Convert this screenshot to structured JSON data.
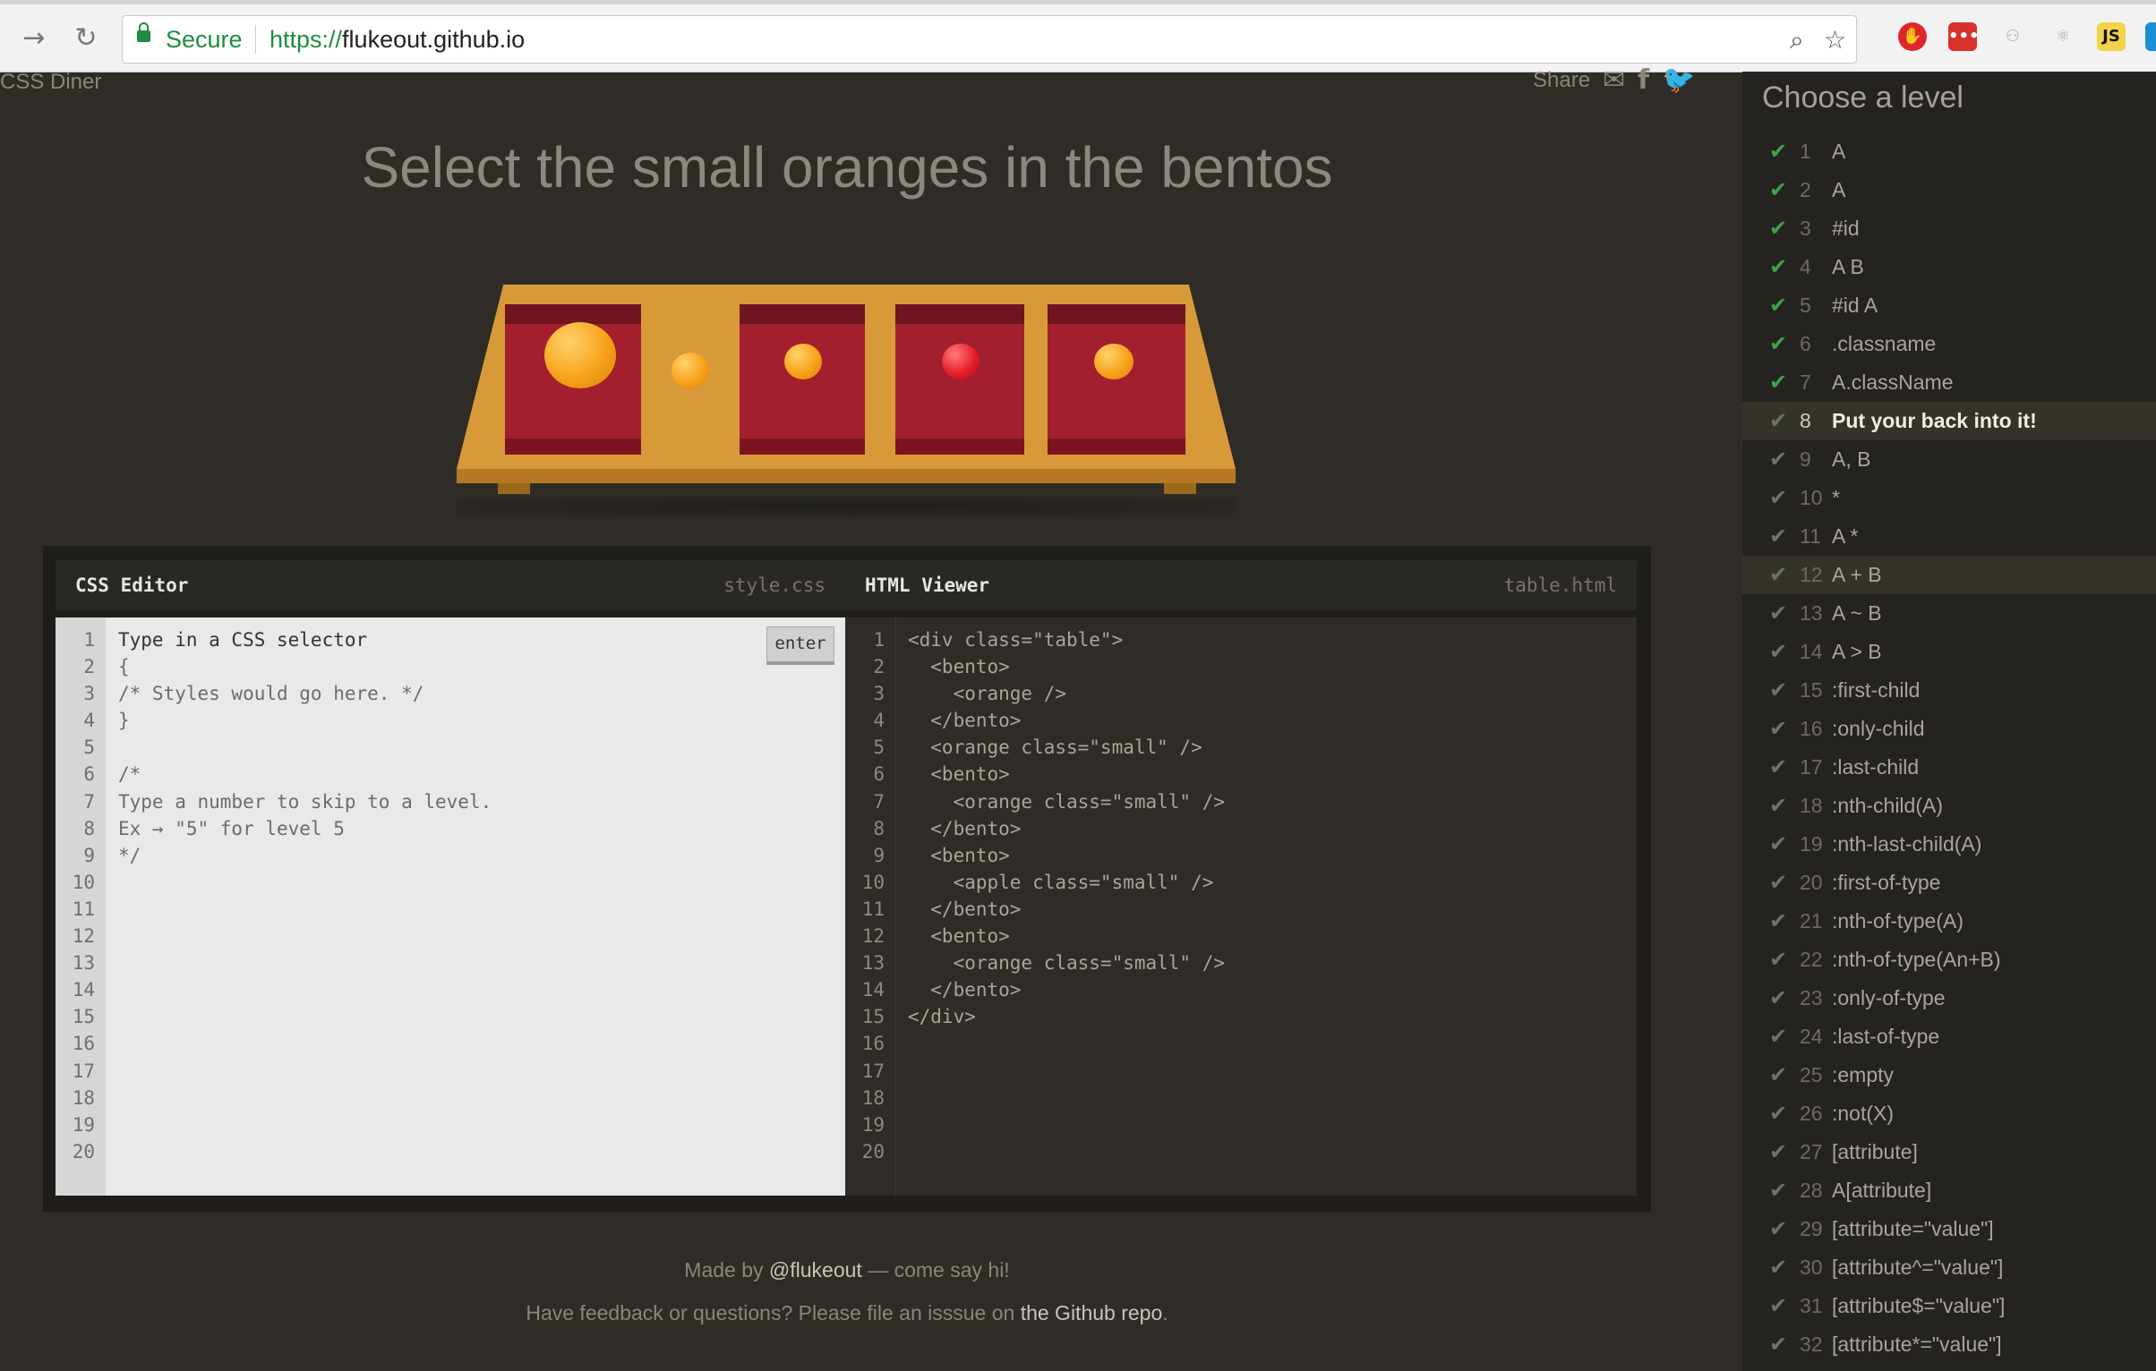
{
  "browser": {
    "secure_label": "Secure",
    "url_scheme": "https://",
    "url_host": "flukeout.github.io"
  },
  "game": {
    "logo": "CSS Diner",
    "share_label": "Share",
    "order": "Select the small oranges in the bentos"
  },
  "css_editor": {
    "title": "CSS Editor",
    "file": "style.css",
    "enter_label": "enter",
    "line_numbers": [
      "1",
      "2",
      "3",
      "4",
      "5",
      "6",
      "7",
      "8",
      "9",
      "10",
      "11",
      "12",
      "13",
      "14",
      "15",
      "16",
      "17",
      "18",
      "19",
      "20"
    ],
    "lines": [
      "Type in a CSS selector",
      "{",
      "/* Styles would go here. */",
      "}",
      "",
      "/*",
      "Type a number to skip to a level.",
      "Ex → \"5\" for level 5",
      "*/"
    ]
  },
  "html_viewer": {
    "title": "HTML Viewer",
    "file": "table.html",
    "line_numbers": [
      "1",
      "2",
      "3",
      "4",
      "5",
      "6",
      "7",
      "8",
      "9",
      "10",
      "11",
      "12",
      "13",
      "14",
      "15",
      "16",
      "17",
      "18",
      "19",
      "20"
    ],
    "lines": [
      "<div class=\"table\">",
      "  <bento>",
      "    <orange />",
      "  </bento>",
      "  <orange class=\"small\" />",
      "  <bento>",
      "    <orange class=\"small\" />",
      "  </bento>",
      "  <bento>",
      "    <apple class=\"small\" />",
      "  </bento>",
      "  <bento>",
      "    <orange class=\"small\" />",
      "  </bento>",
      "</div>"
    ]
  },
  "footer": {
    "made_by_prefix": "Made by ",
    "made_by_handle": "@flukeout",
    "made_by_suffix": " — come say hi!",
    "feedback_prefix": "Have feedback or questions? Please file an isssue on ",
    "feedback_link": "the Github repo",
    "feedback_suffix": "."
  },
  "sidebar": {
    "title": "Choose a level",
    "levels": [
      {
        "num": "1",
        "name": "A"
      },
      {
        "num": "2",
        "name": "A"
      },
      {
        "num": "3",
        "name": "#id"
      },
      {
        "num": "4",
        "name": "A B"
      },
      {
        "num": "5",
        "name": "#id  A"
      },
      {
        "num": "6",
        "name": ".classname"
      },
      {
        "num": "7",
        "name": "A.className"
      },
      {
        "num": "8",
        "name": "Put your back into it!"
      },
      {
        "num": "9",
        "name": "A, B"
      },
      {
        "num": "10",
        "name": "*"
      },
      {
        "num": "11",
        "name": "A *"
      },
      {
        "num": "12",
        "name": "A + B"
      },
      {
        "num": "13",
        "name": "A ~ B"
      },
      {
        "num": "14",
        "name": "A > B"
      },
      {
        "num": "15",
        "name": ":first-child"
      },
      {
        "num": "16",
        "name": ":only-child"
      },
      {
        "num": "17",
        "name": ":last-child"
      },
      {
        "num": "18",
        "name": ":nth-child(A)"
      },
      {
        "num": "19",
        "name": ":nth-last-child(A)"
      },
      {
        "num": "20",
        "name": ":first-of-type"
      },
      {
        "num": "21",
        "name": ":nth-of-type(A)"
      },
      {
        "num": "22",
        "name": ":nth-of-type(An+B)"
      },
      {
        "num": "23",
        "name": ":only-of-type"
      },
      {
        "num": "24",
        "name": ":last-of-type"
      },
      {
        "num": "25",
        "name": ":empty"
      },
      {
        "num": "26",
        "name": ":not(X)"
      },
      {
        "num": "27",
        "name": "[attribute]"
      },
      {
        "num": "28",
        "name": "A[attribute]"
      },
      {
        "num": "29",
        "name": "[attribute=\"value\"]"
      },
      {
        "num": "30",
        "name": "[attribute^=\"value\"]"
      },
      {
        "num": "31",
        "name": "[attribute$=\"value\"]"
      },
      {
        "num": "32",
        "name": "[attribute*=\"value\"]"
      }
    ]
  }
}
